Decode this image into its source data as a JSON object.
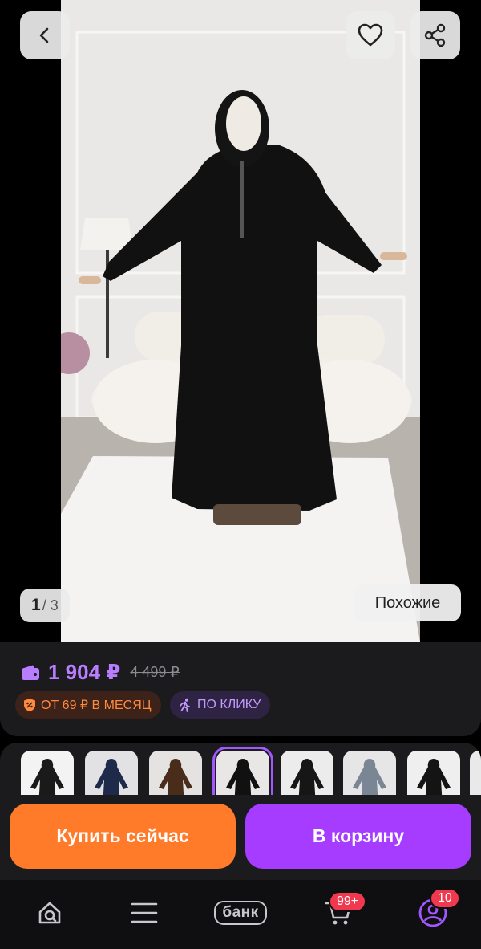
{
  "gallery": {
    "current_index": "1",
    "separator_total": "/ 3",
    "similar_label": "Похожие"
  },
  "product": {
    "price": "1 904 ₽",
    "old_price": "4 499 ₽",
    "installment_label": "ОТ 69 ₽ В МЕСЯЦ",
    "click_label": "ПО КЛИКУ"
  },
  "variants": [
    {
      "color": "#1a1a1a"
    },
    {
      "color": "#1d2a4a"
    },
    {
      "color": "#4a2c1a"
    },
    {
      "color": "#111111",
      "selected": true
    },
    {
      "color": "#161616"
    },
    {
      "color": "#7b8694"
    },
    {
      "color": "#141414"
    }
  ],
  "actions": {
    "buy_now": "Купить сейчас",
    "add_to_cart": "В корзину"
  },
  "nav": {
    "bank_label": "банк",
    "cart_badge": "99+",
    "profile_badge": "10"
  },
  "colors": {
    "price": "#b97dff",
    "buy_button": "#ff7a29",
    "cart_button": "#a53cff",
    "badge": "#f0384f"
  }
}
